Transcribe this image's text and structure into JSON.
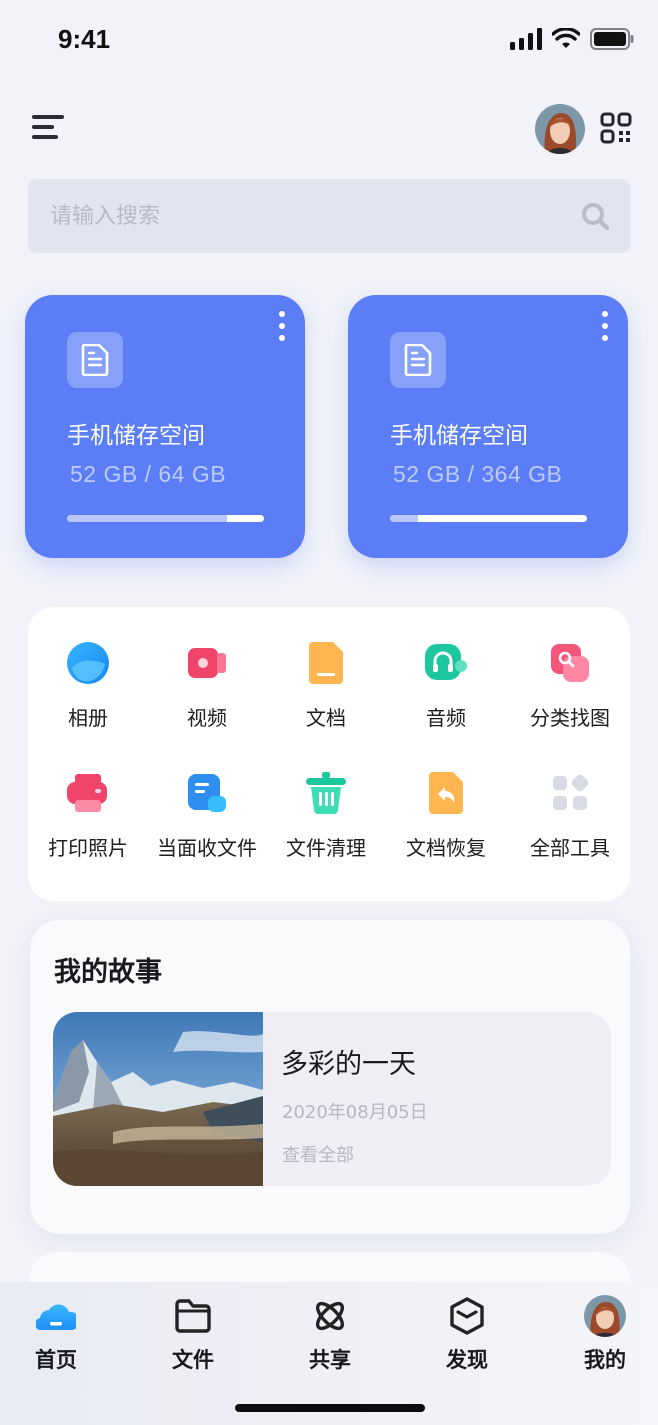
{
  "status_bar": {
    "time": "9:41"
  },
  "search": {
    "placeholder": "请输入搜索"
  },
  "storage_cards": [
    {
      "title": "手机储存空间",
      "usage": "52 GB / 64 GB",
      "fraction": 0.8125
    },
    {
      "title": "手机储存空间",
      "usage": "52 GB / 364 GB",
      "fraction": 0.1429
    }
  ],
  "tools": [
    {
      "label": "相册",
      "icon": "album-icon"
    },
    {
      "label": "视频",
      "icon": "video-icon"
    },
    {
      "label": "文档",
      "icon": "document-icon"
    },
    {
      "label": "音频",
      "icon": "audio-icon"
    },
    {
      "label": "分类找图",
      "icon": "image-search-icon"
    },
    {
      "label": "打印照片",
      "icon": "print-photo-icon"
    },
    {
      "label": "当面收文件",
      "icon": "receive-file-icon"
    },
    {
      "label": "文件清理",
      "icon": "clean-icon"
    },
    {
      "label": "文档恢复",
      "icon": "restore-icon"
    },
    {
      "label": "全部工具",
      "icon": "all-tools-icon"
    }
  ],
  "story": {
    "section_title": "我的故事",
    "item": {
      "name": "多彩的一天",
      "date": "2020年08月05日",
      "link": "查看全部"
    }
  },
  "tabbar": [
    {
      "label": "首页",
      "icon": "home-icon",
      "active": true
    },
    {
      "label": "文件",
      "icon": "folder-icon",
      "active": false
    },
    {
      "label": "共享",
      "icon": "share-icon",
      "active": false
    },
    {
      "label": "发现",
      "icon": "discover-icon",
      "active": false
    },
    {
      "label": "我的",
      "icon": "profile-avatar-icon",
      "active": false
    }
  ],
  "colors": {
    "accent": "#5b7df6",
    "background": "#f2f3f9",
    "card": "#ffffff",
    "muted_text": "#b7b7c0"
  }
}
